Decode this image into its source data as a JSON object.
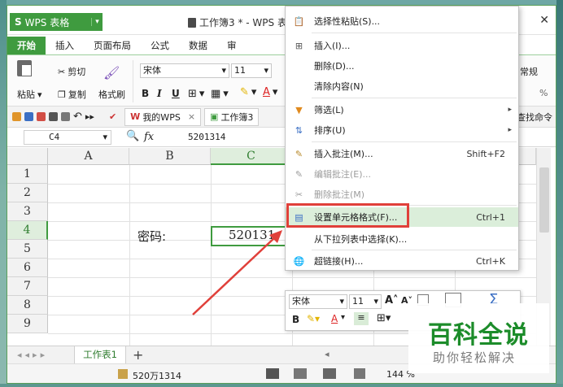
{
  "app": {
    "name": "WPS 表格",
    "document_title": "工作簿3 * - WPS 表格"
  },
  "ribbon": {
    "tabs": [
      "开始",
      "插入",
      "页面布局",
      "公式",
      "数据",
      "审"
    ],
    "paste_label": "粘贴",
    "cut_label": "剪切",
    "copy_label": "复制",
    "format_painter_label": "格式刷",
    "font_name": "宋体",
    "font_size": "11",
    "right_group_label": "常规",
    "percent_symbol": "%",
    "find_label": "查找命令"
  },
  "quickbar": {
    "tab_mywps": "我的WPS",
    "tab_doc": "工作簿3"
  },
  "formula_bar": {
    "cell_ref": "C4",
    "fx": "fx",
    "value": "5201314"
  },
  "grid": {
    "columns": [
      "A",
      "B",
      "C"
    ],
    "rows": [
      "1",
      "2",
      "3",
      "4",
      "5",
      "6",
      "7",
      "8",
      "9"
    ],
    "b4": "密码:",
    "c4": "520131"
  },
  "sheet_tabs": {
    "active": "工作表1",
    "add": "+"
  },
  "status": {
    "sum_value": "520万1314",
    "zoom": "144 %"
  },
  "context_menu": {
    "items": [
      {
        "label": "选择性粘贴(S)...",
        "icon": "paste-special-icon",
        "shortcut": "",
        "disabled": false
      },
      {
        "label": "插入(I)...",
        "icon": "insert-icon",
        "shortcut": "",
        "disabled": false
      },
      {
        "label": "删除(D)...",
        "icon": "",
        "shortcut": "",
        "disabled": false
      },
      {
        "label": "清除内容(N)",
        "icon": "",
        "shortcut": "",
        "disabled": false
      },
      {
        "label": "筛选(L)",
        "icon": "filter-icon",
        "shortcut": "",
        "disabled": false,
        "submenu": true
      },
      {
        "label": "排序(U)",
        "icon": "sort-icon",
        "shortcut": "",
        "disabled": false,
        "submenu": true
      },
      {
        "label": "插入批注(M)...",
        "icon": "insert-comment-icon",
        "shortcut": "Shift+F2",
        "disabled": false
      },
      {
        "label": "编辑批注(E)...",
        "icon": "edit-comment-icon",
        "shortcut": "",
        "disabled": true
      },
      {
        "label": "删除批注(M)",
        "icon": "delete-comment-icon",
        "shortcut": "",
        "disabled": true
      },
      {
        "label": "设置单元格格式(F)...",
        "icon": "format-cells-icon",
        "shortcut": "Ctrl+1",
        "disabled": false,
        "highlighted": true
      },
      {
        "label": "从下拉列表中选择(K)...",
        "icon": "",
        "shortcut": "",
        "disabled": false
      },
      {
        "label": "超链接(H)...",
        "icon": "hyperlink-icon",
        "shortcut": "Ctrl+K",
        "disabled": false
      }
    ]
  },
  "mini_toolbar": {
    "font_name": "宋体",
    "font_size": "11"
  },
  "watermark": {
    "title": "百科全说",
    "subtitle": "助你轻松解决"
  },
  "colors": {
    "accent": "#3f9b3f",
    "highlight_box": "#e0403a",
    "menu_highlight": "#dbeeda"
  }
}
